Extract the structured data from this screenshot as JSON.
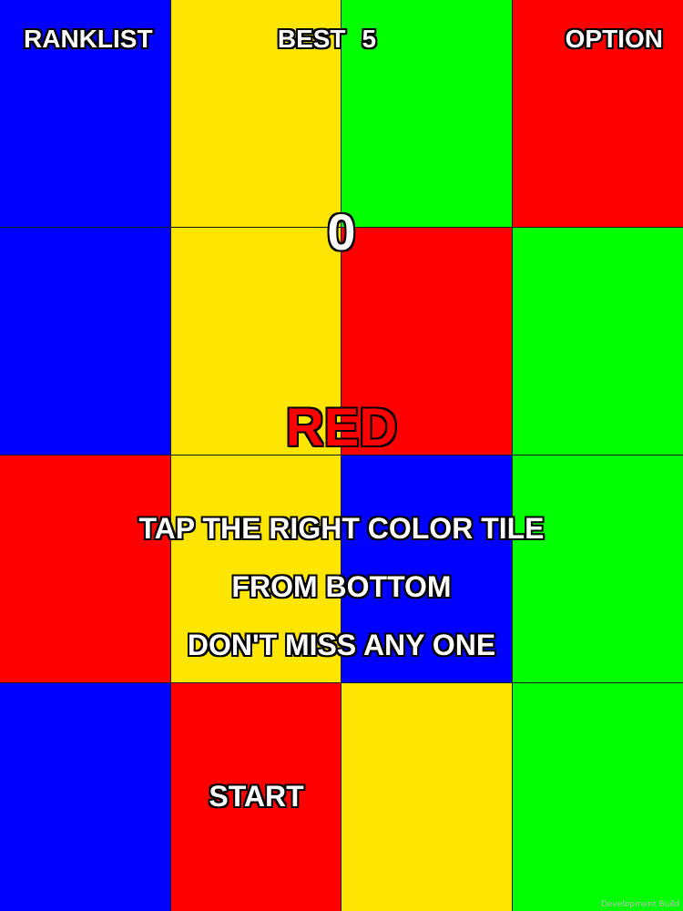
{
  "top_bar": {
    "ranklist_label": "RANKLIST",
    "best_label": "BEST",
    "best_value": "5",
    "option_label": "OPTION"
  },
  "score": "0",
  "target_color": {
    "word": "RED",
    "color": "#ff0000"
  },
  "instructions": [
    "TAP THE RIGHT COLOR TILE",
    "FROM BOTTOM",
    "DON'T MISS ANY ONE"
  ],
  "start_label": "START",
  "watermark": "Development Build",
  "palette": {
    "blue": "#0000ff",
    "yellow": "#ffe600",
    "green": "#00ff00",
    "red": "#ff0000"
  },
  "tiles": [
    [
      "blue",
      "yellow",
      "green",
      "red"
    ],
    [
      "blue",
      "yellow",
      "red",
      "green"
    ],
    [
      "red",
      "yellow",
      "blue",
      "green"
    ],
    [
      "blue",
      "red",
      "yellow",
      "green"
    ]
  ]
}
